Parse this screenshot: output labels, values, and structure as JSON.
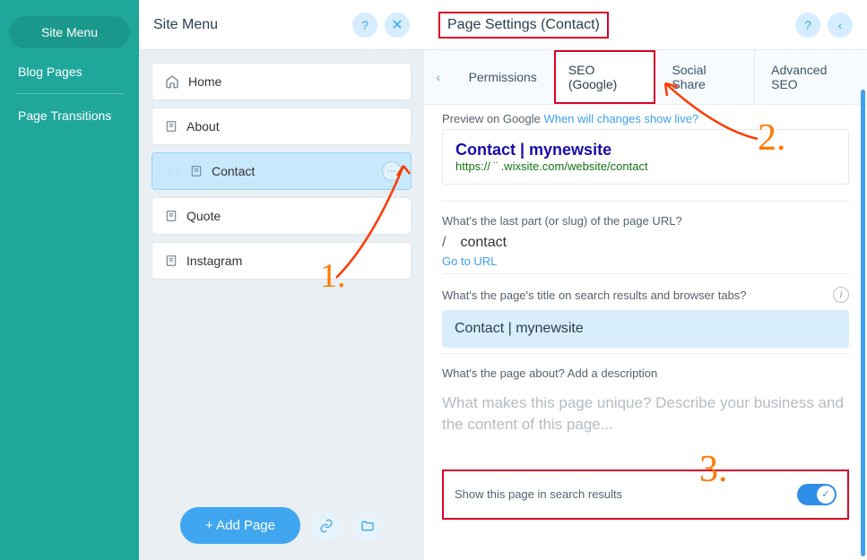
{
  "colors": {
    "accent": "#3fa6ef",
    "teal": "#1fa79b",
    "highlight_red": "#d9032a",
    "annot_orange": "#ff7a00"
  },
  "sidebar": {
    "items": [
      {
        "label": "Site Menu",
        "active": true
      },
      {
        "label": "Blog Pages",
        "active": false
      },
      {
        "label": "Page Transitions",
        "active": false
      }
    ]
  },
  "middle": {
    "title": "Site Menu",
    "help_icon": "?",
    "close_icon": "✕",
    "pages": [
      {
        "label": "Home",
        "icon": "home"
      },
      {
        "label": "About",
        "icon": "page"
      },
      {
        "label": "Contact",
        "icon": "page",
        "selected": true
      },
      {
        "label": "Quote",
        "icon": "page"
      },
      {
        "label": "Instagram",
        "icon": "page"
      }
    ],
    "more_icon": "⋯",
    "add_page": "+ Add Page",
    "link_icon": "link",
    "folder_icon": "folder"
  },
  "right": {
    "title": "Page Settings (Contact)",
    "help_icon": "?",
    "back_icon": "‹",
    "tab_back": "‹",
    "tabs": [
      {
        "label": "Permissions"
      },
      {
        "label": "SEO (Google)",
        "active": true,
        "boxed": true
      },
      {
        "label": "Social Share"
      },
      {
        "label": "Advanced SEO"
      }
    ],
    "preview_label_a": "Preview on Google ",
    "preview_label_b": "When will changes show live?",
    "google_preview": {
      "title": "Contact | mynewsite",
      "url": "https://   ¨   .wixsite.com/website/contact"
    },
    "slug": {
      "question": "What's the last part (or slug) of the page URL?",
      "slash": "/",
      "value": "contact",
      "go": "Go to URL"
    },
    "title_field": {
      "question": "What's the page's title on search results and browser tabs?",
      "value": "Contact | mynewsite",
      "info": "i"
    },
    "desc": {
      "question": "What's the page about? Add a description",
      "placeholder": "What makes this page unique? Describe your business and the content of this page..."
    },
    "toggle": {
      "label": "Show this page in search results",
      "checked": true,
      "check": "✓"
    }
  },
  "annotations": {
    "n1": "1.",
    "n2": "2.",
    "n3": "3."
  }
}
